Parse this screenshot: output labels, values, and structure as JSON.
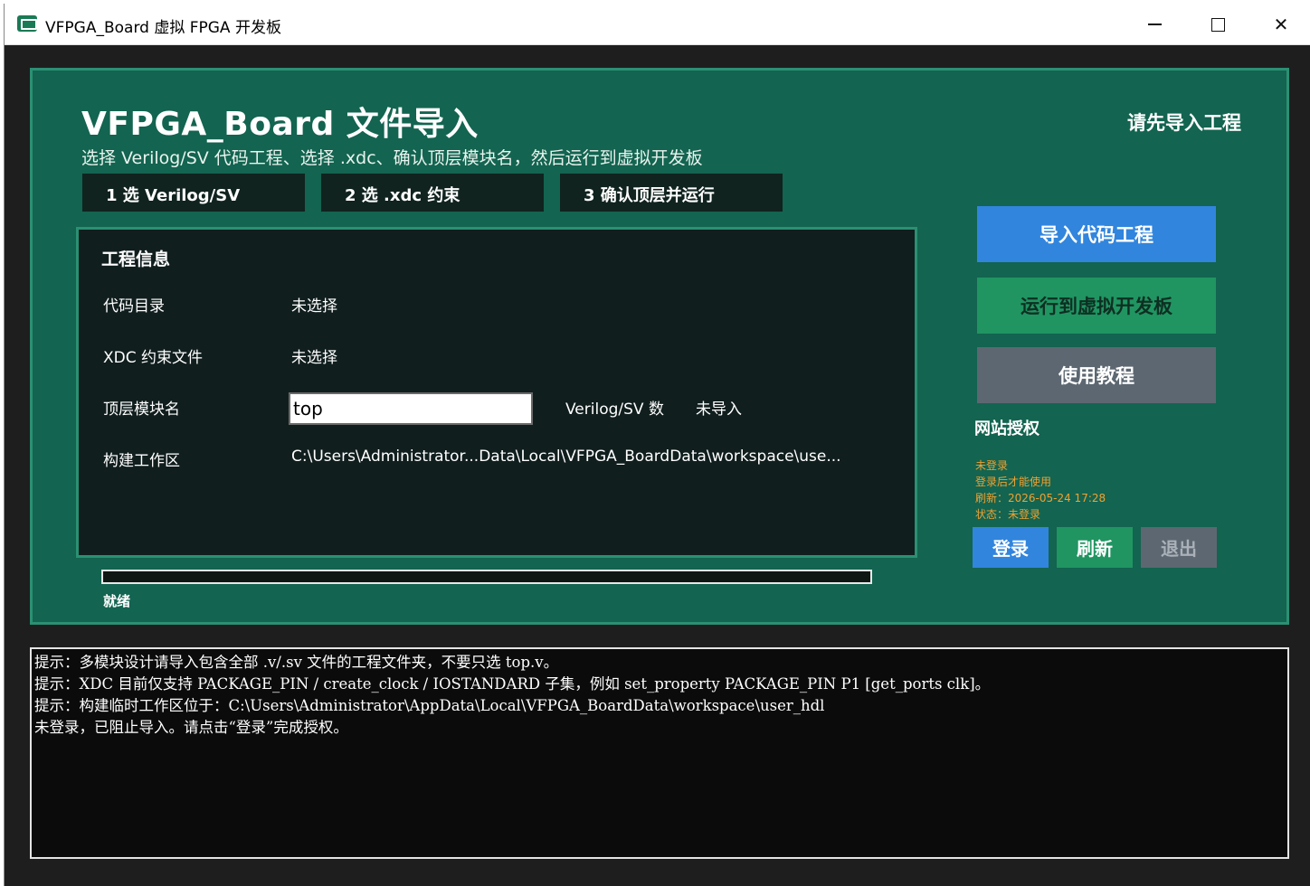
{
  "window": {
    "title": "VFPGA_Board 虚拟 FPGA 开发板"
  },
  "header": {
    "title": "VFPGA_Board 文件导入",
    "subtitle": "选择 Verilog/SV 代码工程、选择 .xdc、确认顶层模块名，然后运行到虚拟开发板",
    "status": "请先导入工程"
  },
  "steps": [
    {
      "label": "1  选 Verilog/SV"
    },
    {
      "label": "2  选 .xdc 约束"
    },
    {
      "label": "3  确认顶层并运行"
    }
  ],
  "project_info": {
    "title": "工程信息",
    "code_dir_label": "代码目录",
    "code_dir_value": "未选择",
    "xdc_label": "XDC 约束文件",
    "xdc_value": "未选择",
    "top_label": "顶层模块名",
    "top_value": "top",
    "verilog_count_label": "Verilog/SV 数",
    "verilog_count_value": "未导入",
    "workspace_label": "构建工作区",
    "workspace_value": "C:\\Users\\Administrator...Data\\Local\\VFPGA_BoardData\\workspace\\use..."
  },
  "progress": {
    "value": 0,
    "status": "就绪"
  },
  "actions": {
    "import_label": "导入代码工程",
    "run_label": "运行到虚拟开发板",
    "tutorial_label": "使用教程"
  },
  "auth": {
    "title": "网站授权",
    "lines": [
      "未登录",
      "登录后才能使用",
      "刷新：2026-05-24 17:28",
      "状态：未登录"
    ],
    "login_label": "登录",
    "refresh_label": "刷新",
    "logout_label": "退出"
  },
  "console": {
    "lines": [
      "提示：多模块设计请导入包含全部 .v/.sv 文件的工程文件夹，不要只选 top.v。",
      "提示：XDC 目前仅支持 PACKAGE_PIN / create_clock / IOSTANDARD 子集，例如 set_property PACKAGE_PIN P1 [get_ports clk]。",
      "提示：构建临时工作区位于：C:\\Users\\Administrator\\AppData\\Local\\VFPGA_BoardData\\workspace\\user_hdl",
      "未登录，已阻止导入。请点击“登录”完成授权。"
    ]
  },
  "colors": {
    "panel_bg": "#136450",
    "panel_border": "#2b9073",
    "primary_blue": "#3185dd",
    "primary_green": "#209562",
    "neutral_gray": "#5d6771",
    "auth_text": "#f0a132"
  }
}
